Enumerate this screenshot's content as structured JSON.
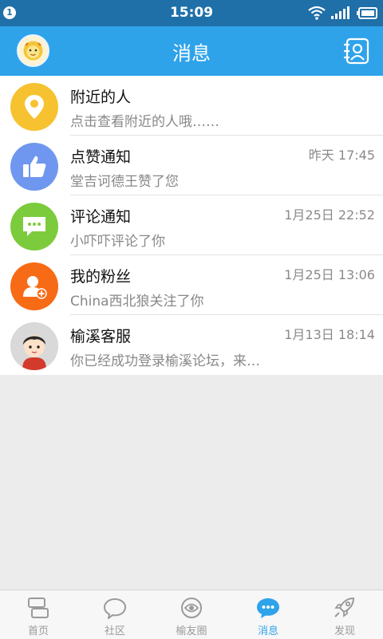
{
  "status_bar": {
    "notification_count": "1",
    "time": "15:09"
  },
  "header": {
    "title": "消息",
    "avatar_icon": "lion-avatar-icon",
    "right_icon": "contacts-icon"
  },
  "messages": [
    {
      "title": "附近的人",
      "subtitle": "点击查看附近的人哦……",
      "time": "",
      "icon": "location-pin-icon",
      "color": "#f6c230"
    },
    {
      "title": "点赞通知",
      "subtitle": "堂吉诃德王赞了您",
      "time": "昨天 17:45",
      "icon": "thumbs-up-icon",
      "color": "#6f97ef"
    },
    {
      "title": "评论通知",
      "subtitle": "小吓吓评论了你",
      "time": "1月25日 22:52",
      "icon": "comment-icon",
      "color": "#7ccb3c"
    },
    {
      "title": "我的粉丝",
      "subtitle": "China西北狼关注了你",
      "time": "1月25日 13:06",
      "icon": "add-fan-icon",
      "color": "#f76b16"
    },
    {
      "title": "榆溪客服",
      "subtitle": "你已经成功登录榆溪论坛，来…",
      "time": "1月13日 18:14",
      "icon": "service-avatar-icon",
      "color": "#d6d6d6"
    }
  ],
  "tabs": [
    {
      "label": "首页",
      "icon": "home-icon",
      "active": false
    },
    {
      "label": "社区",
      "icon": "community-icon",
      "active": false
    },
    {
      "label": "榆友圈",
      "icon": "friends-circle-icon",
      "active": false
    },
    {
      "label": "消息",
      "icon": "message-icon",
      "active": true
    },
    {
      "label": "发现",
      "icon": "rocket-icon",
      "active": false
    }
  ],
  "colors": {
    "accent": "#2fa3ea",
    "status_bar": "#1f6fa8",
    "background": "#ececec"
  }
}
